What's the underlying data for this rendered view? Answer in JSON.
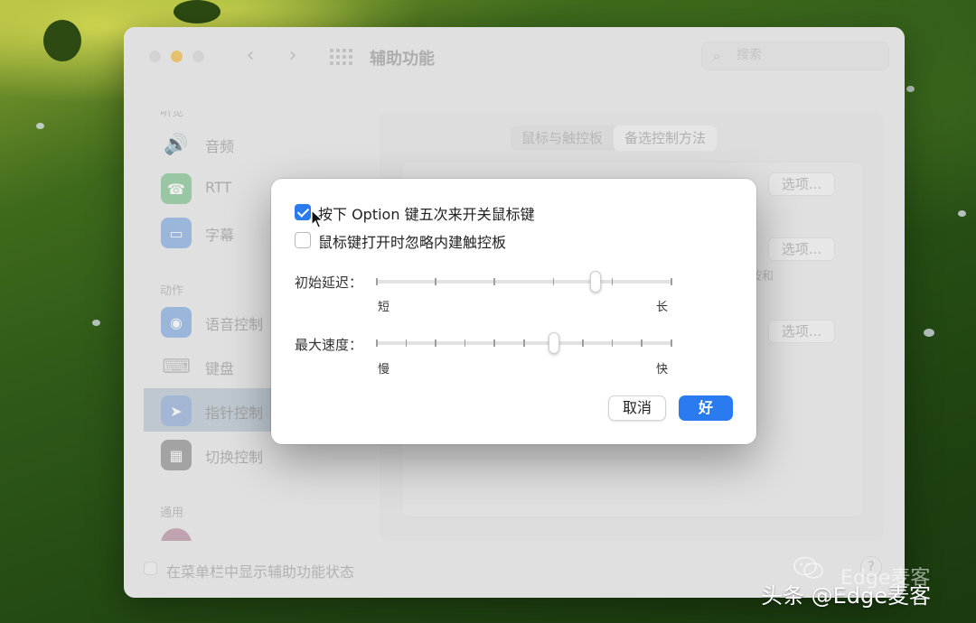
{
  "window": {
    "title": "辅助功能",
    "search_placeholder": "搜索",
    "nav_back": "‹",
    "nav_forward": "›"
  },
  "sidebar": {
    "section_top_partial": "听觉",
    "items_hearing": [
      {
        "label": "音频",
        "icon": "speaker-icon"
      },
      {
        "label": "RTT",
        "icon": "telephone-icon"
      },
      {
        "label": "字幕",
        "icon": "caption-icon"
      }
    ],
    "section_motor": "动作",
    "items_motor": [
      {
        "label": "语音控制",
        "icon": "voice-control-icon"
      },
      {
        "label": "键盘",
        "icon": "keyboard-icon"
      },
      {
        "label": "指针控制",
        "icon": "pointer-icon",
        "active": true
      },
      {
        "label": "切换控制",
        "icon": "switch-control-icon"
      }
    ],
    "section_general": "通用"
  },
  "main": {
    "tabs": [
      {
        "label": "鼠标与触控板",
        "selected": false
      },
      {
        "label": "备选控制方法",
        "selected": true
      }
    ],
    "options_buttons": [
      "选项...",
      "选项...",
      "选项..."
    ],
    "partial_text": "按和"
  },
  "footer": {
    "show_status_label": "在菜单栏中显示辅助功能状态",
    "help": "?"
  },
  "dialog": {
    "checkbox_option_toggle": {
      "label": "按下 Option 键五次来开关鼠标键",
      "checked": true
    },
    "checkbox_ignore_trackpad": {
      "label": "鼠标键打开时忽略内建触控板",
      "checked": false
    },
    "initial_delay": {
      "label": "初始延迟：",
      "min_label": "短",
      "max_label": "长",
      "value": 0.74,
      "ticks": 6
    },
    "max_speed": {
      "label": "最大速度：",
      "min_label": "慢",
      "max_label": "快",
      "value": 0.6,
      "ticks": 11
    },
    "cancel_label": "取消",
    "ok_label": "好"
  },
  "watermark": {
    "line1": "Edge麦客",
    "line2": "头条 @Edge麦客"
  },
  "colors": {
    "accent": "#2a7bf0",
    "minimize": "#f2b838"
  }
}
